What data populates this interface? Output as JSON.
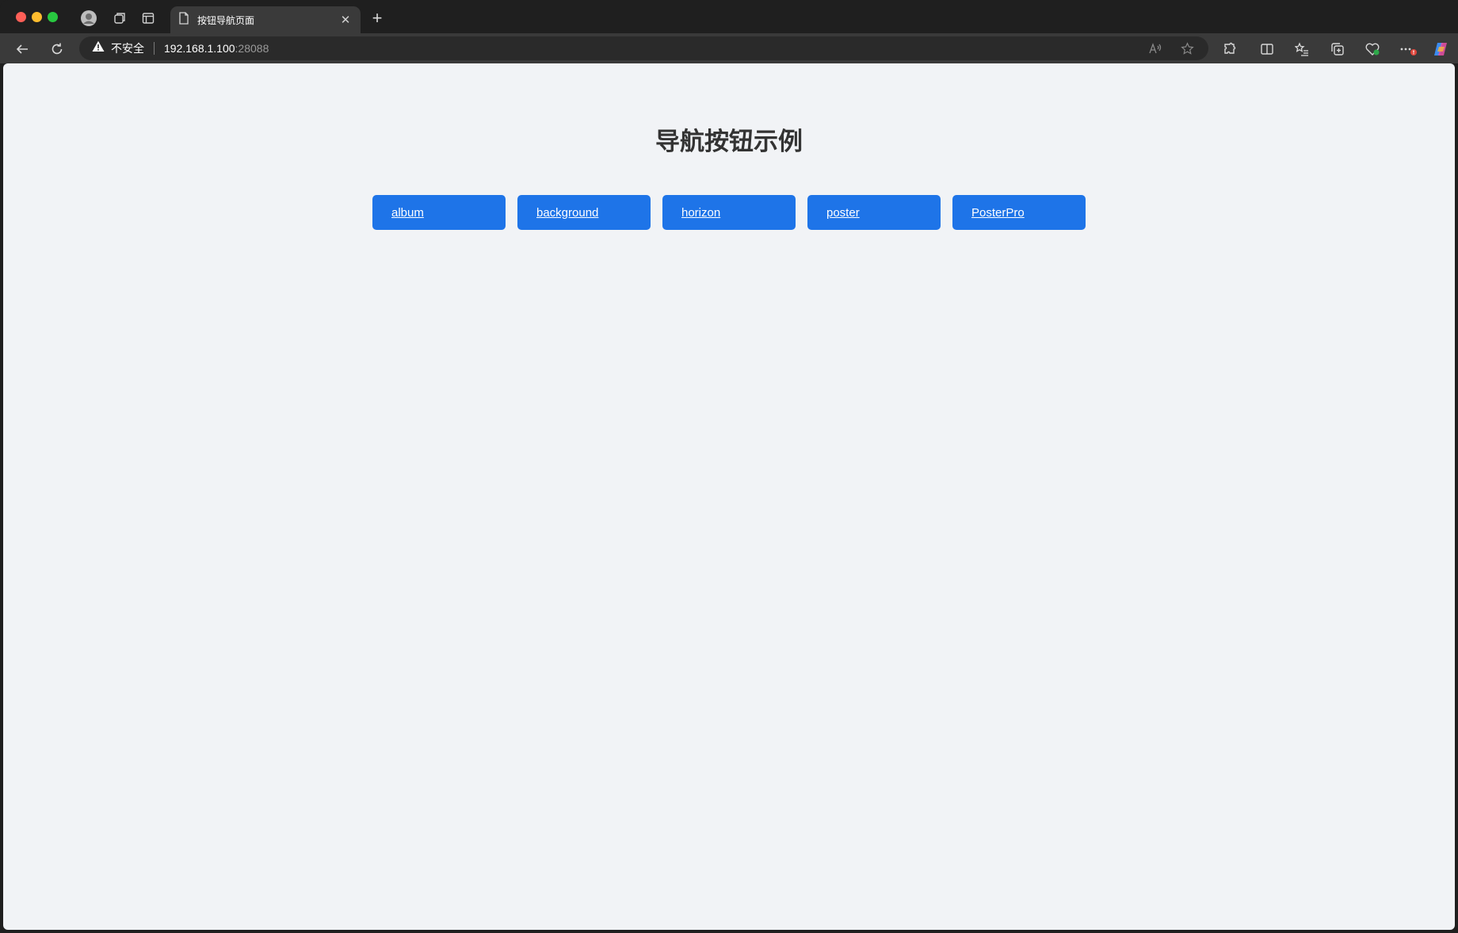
{
  "browser": {
    "tab": {
      "title": "按钮导航页面"
    },
    "address": {
      "security_label": "不安全",
      "host": "192.168.1.100",
      "port": ":28088"
    }
  },
  "page": {
    "heading": "导航按钮示例",
    "buttons": [
      {
        "label": "album"
      },
      {
        "label": "background"
      },
      {
        "label": "horizon"
      },
      {
        "label": "poster"
      },
      {
        "label": "PosterPro"
      }
    ]
  },
  "colors": {
    "button_bg": "#1e74e8",
    "page_bg": "#f1f3f6",
    "heading": "#333333"
  }
}
